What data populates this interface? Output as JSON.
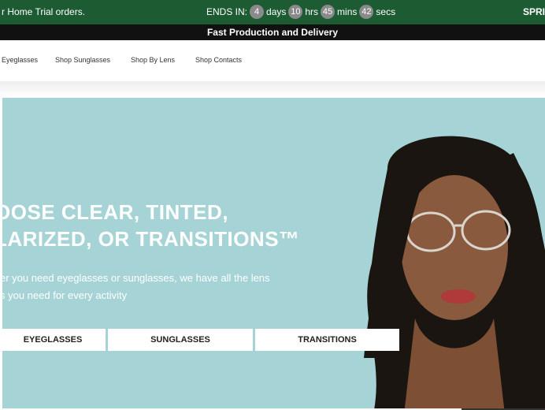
{
  "promo": {
    "left_text": "r Home Trial orders.",
    "ends_in": "ENDS IN:",
    "days_value": "4",
    "days_label": "days",
    "hours_value": "10",
    "hours_label": "hrs",
    "mins_value": "45",
    "mins_label": "mins",
    "secs_value": "42",
    "secs_label": "secs",
    "right_text": "SPRI"
  },
  "delivery": {
    "text": "Fast Production and Delivery"
  },
  "nav": {
    "items": [
      {
        "label": "Eyeglasses"
      },
      {
        "label": "Shop Sunglasses"
      },
      {
        "label": "Shop By Lens"
      },
      {
        "label": "Shop Contacts"
      }
    ]
  },
  "hero": {
    "title_line1": "OOSE CLEAR, TINTED,",
    "title_line2": "LARIZED, OR TRANSITIONS™",
    "subtitle_line1": "er you need eyeglasses or sunglasses, we have all the lens",
    "subtitle_line2": "s you need for every activity",
    "buttons": [
      {
        "label": "EYEGLASSES"
      },
      {
        "label": "SUNGLASSES"
      },
      {
        "label": "TRANSITIONS"
      }
    ]
  },
  "colors": {
    "promo_bg": "#1d5b33",
    "delivery_bg": "#111111",
    "hero_bg": "#a6d4d6"
  }
}
